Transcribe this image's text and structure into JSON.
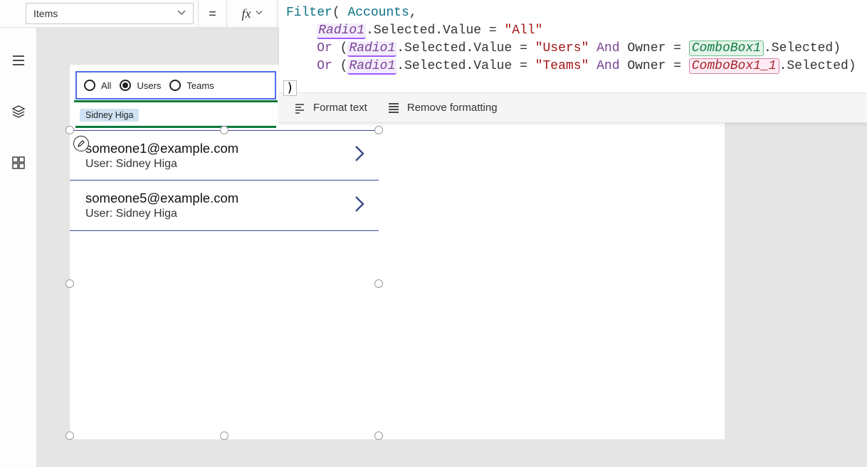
{
  "property_selector": {
    "value": "Items"
  },
  "equals": "=",
  "fx_label": "fx",
  "formula": {
    "fn": "Filter",
    "datasource": "Accounts",
    "radio_ref": "Radio1",
    "combo_ref_1": "ComboBox1",
    "combo_ref_2": "ComboBox1_1",
    "sel_path": ".Selected.Value",
    "sel_suffix": ".Selected",
    "eq": " = ",
    "or": "Or ",
    "and": " And ",
    "owner": "Owner",
    "str_all": "\"All\"",
    "str_users": "\"Users\"",
    "str_teams": "\"Teams\"",
    "open_paren": "(",
    "close_paren": ")",
    "comma": ","
  },
  "formula_toolbar": {
    "format": "Format text",
    "remove": "Remove formatting"
  },
  "left_rail": {
    "tree": "tree-view",
    "insert": "insert",
    "components": "components"
  },
  "radio": {
    "options": [
      "All",
      "Users",
      "Teams"
    ],
    "selected_index": 1
  },
  "combobox": {
    "chip": "Sidney Higa"
  },
  "gallery": {
    "rows": [
      {
        "title": "someone1@example.com",
        "subtitle": "User: Sidney Higa"
      },
      {
        "title": "someone5@example.com",
        "subtitle": "User: Sidney Higa"
      }
    ]
  }
}
